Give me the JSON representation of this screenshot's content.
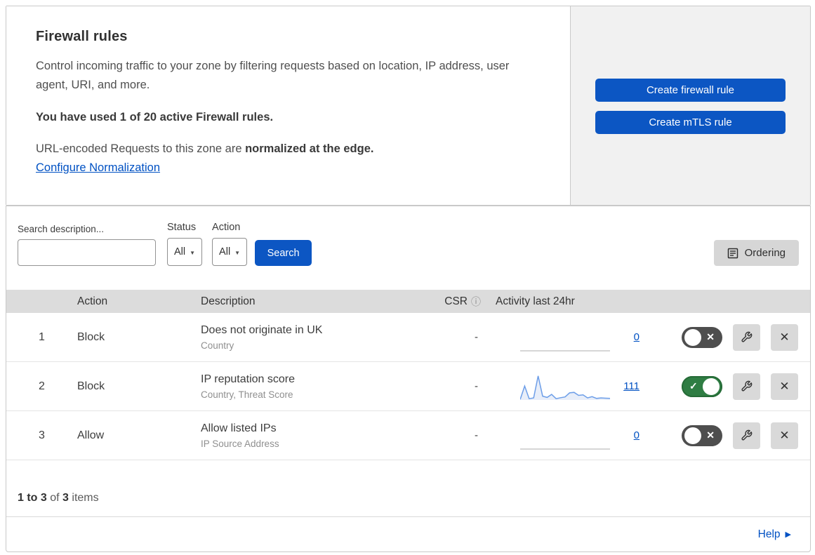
{
  "header": {
    "title": "Firewall rules",
    "description": "Control incoming traffic to your zone by filtering requests based on location, IP address, user agent, URI, and more.",
    "usage": "You have used 1 of 20 active Firewall rules.",
    "norm_text": "URL-encoded Requests to this zone are ",
    "norm_bold": "normalized at the edge.",
    "norm_link": "Configure Normalization",
    "create_firewall_label": "Create firewall rule",
    "create_mtls_label": "Create mTLS rule"
  },
  "filters": {
    "search_label": "Search description...",
    "search_placeholder": "",
    "search_value": "",
    "status_label": "Status",
    "status_value": "All",
    "action_label": "Action",
    "action_value": "All",
    "search_button": "Search",
    "ordering_label": "Ordering"
  },
  "table": {
    "columns": [
      "Action",
      "Description",
      "CSR",
      "Activity last 24hr"
    ],
    "rows": [
      {
        "priority": "1",
        "action": "Block",
        "description": "Does not originate in UK",
        "fields": "Country",
        "csr": "-",
        "count": "0",
        "enabled": false,
        "sparkline": {
          "points": [
            0,
            0
          ],
          "color": "#c9c9c9",
          "fill": "none"
        }
      },
      {
        "priority": "2",
        "action": "Block",
        "description": "IP reputation score",
        "fields": "Country, Threat Score",
        "csr": "-",
        "count": "111",
        "enabled": true,
        "sparkline": {
          "points": [
            2,
            55,
            5,
            8,
            95,
            15,
            10,
            22,
            5,
            9,
            12,
            28,
            30,
            18,
            20,
            8,
            13,
            6,
            8,
            7,
            6
          ],
          "color": "#6d9ee8",
          "fill": "#e8eef9"
        }
      },
      {
        "priority": "3",
        "action": "Allow",
        "description": "Allow listed IPs",
        "fields": "IP Source Address",
        "csr": "-",
        "count": "0",
        "enabled": false,
        "sparkline": {
          "points": [
            0,
            0
          ],
          "color": "#c9c9c9",
          "fill": "none"
        }
      }
    ]
  },
  "footer": {
    "range": "1 to 3",
    "of_text": " of ",
    "total": "3",
    "items_text": " items",
    "help_label": "Help"
  },
  "icons": {
    "info_glyph": "ⓘ",
    "caret_glyph": "▼",
    "close_glyph": "✕",
    "toggle_on_glyph": "✓",
    "toggle_off_glyph": "✕",
    "help_arrow_glyph": "▶"
  },
  "colors": {
    "accent_blue": "#0c56c3",
    "link_blue": "#0051c3",
    "toggle_on_green": "#2f7d43",
    "toggle_off_gray": "#4e4e4e",
    "table_header_bg": "#dcdcdc",
    "side_panel_bg": "#f1f1f1",
    "sparkline_blue": "#6d9ee8"
  }
}
